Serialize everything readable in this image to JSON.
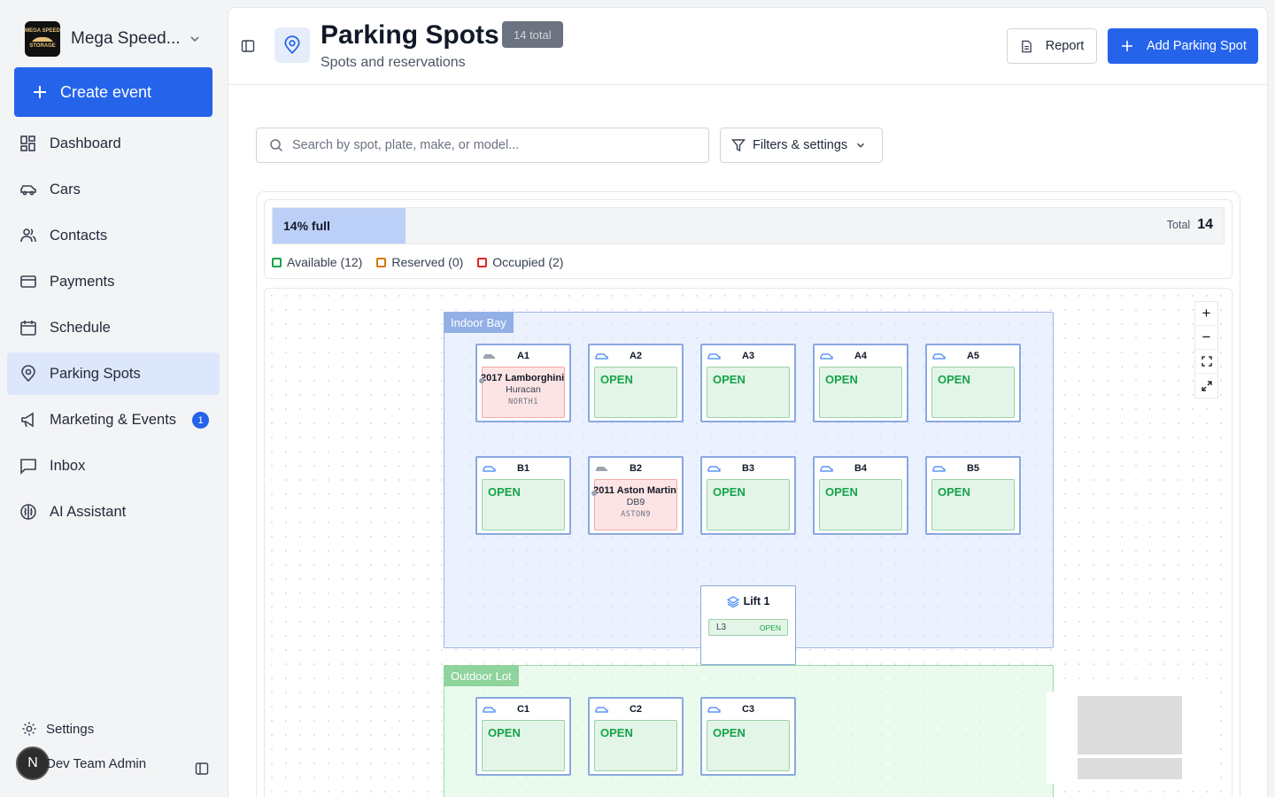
{
  "brand": {
    "name": "Mega Speed...",
    "logo_text": [
      "MEGA SPEED",
      "STORAGE"
    ]
  },
  "sidebar": {
    "create_label": "Create event",
    "items": [
      {
        "label": "Dashboard",
        "icon": "dashboard-icon"
      },
      {
        "label": "Cars",
        "icon": "car-icon"
      },
      {
        "label": "Contacts",
        "icon": "users-icon"
      },
      {
        "label": "Payments",
        "icon": "credit-card-icon"
      },
      {
        "label": "Schedule",
        "icon": "calendar-icon"
      },
      {
        "label": "Parking Spots",
        "icon": "map-pin-icon",
        "active": true
      },
      {
        "label": "Marketing & Events",
        "icon": "megaphone-icon",
        "badge": "1"
      },
      {
        "label": "Inbox",
        "icon": "message-icon"
      },
      {
        "label": "AI Assistant",
        "icon": "brain-icon"
      }
    ],
    "settings_label": "Settings",
    "user": {
      "initial": "N",
      "name": "Dev Team Admin"
    }
  },
  "header": {
    "title": "Parking Spots",
    "total_badge": "14 total",
    "subtitle": "Spots and reservations",
    "report_label": "Report",
    "add_label": "Add Parking Spot"
  },
  "search": {
    "placeholder": "Search by spot, plate, make, or model..."
  },
  "filters": {
    "label": "Filters & settings"
  },
  "stats": {
    "fill_label": "14% full",
    "fill_percent": 14,
    "total_label": "Total",
    "total_value": "14",
    "legend": [
      {
        "label": "Available (12)",
        "color": "#16a34a"
      },
      {
        "label": "Reserved (0)",
        "color": "#d97706"
      },
      {
        "label": "Occupied (2)",
        "color": "#dc2626"
      }
    ]
  },
  "zones": {
    "indoor": "Indoor Bay",
    "outdoor": "Outdoor Lot"
  },
  "spots": {
    "A1": {
      "name": "A1",
      "status": "occupied",
      "line1": "2017 Lamborghini",
      "line2": "Huracan",
      "plate": "NORTH1"
    },
    "A2": {
      "name": "A2",
      "status": "OPEN"
    },
    "A3": {
      "name": "A3",
      "status": "OPEN"
    },
    "A4": {
      "name": "A4",
      "status": "OPEN"
    },
    "A5": {
      "name": "A5",
      "status": "OPEN"
    },
    "B1": {
      "name": "B1",
      "status": "OPEN"
    },
    "B2": {
      "name": "B2",
      "status": "occupied",
      "line1": "2011 Aston Martin",
      "line2": "DB9",
      "plate": "ASTON9"
    },
    "B3": {
      "name": "B3",
      "status": "OPEN"
    },
    "B4": {
      "name": "B4",
      "status": "OPEN"
    },
    "B5": {
      "name": "B5",
      "status": "OPEN"
    },
    "C1": {
      "name": "C1",
      "status": "OPEN"
    },
    "C2": {
      "name": "C2",
      "status": "OPEN"
    },
    "C3": {
      "name": "C3",
      "status": "OPEN"
    }
  },
  "lift": {
    "name": "Lift 1",
    "level": "L3",
    "status": "OPEN"
  },
  "zoom": {
    "in": "+",
    "out": "−"
  }
}
